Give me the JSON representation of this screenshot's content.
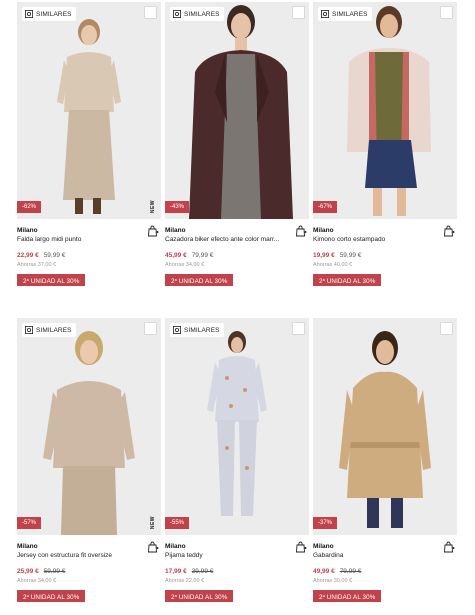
{
  "labels": {
    "similares": "SIMILARES",
    "new": "NEW",
    "promo_sup": "a",
    "promo_prefix": "2",
    "promo_suffix": " UNIDAD AL 30%"
  },
  "colors": {
    "accent": "#c0434b",
    "bg": "#ececec"
  },
  "products": [
    {
      "brand": "Milano",
      "name": "Falda largo midi punto",
      "discount": "-62%",
      "price": "22,99 €",
      "old_price": "59,99 €",
      "ahorras": "Ahorras 37,00 €",
      "new": true
    },
    {
      "brand": "Milano",
      "name": "Cazadora biker efecto ante color marr...",
      "discount": "-43%",
      "price": "45,99 €",
      "old_price": "79,99 €",
      "ahorras": "Ahorras 34,00 €",
      "new": false
    },
    {
      "brand": "Milano",
      "name": "Kimono corto estampado",
      "discount": "-67%",
      "price": "19,99 €",
      "old_price": "59,99 €",
      "ahorras": "Ahorras 40,00 €",
      "new": false
    },
    {
      "brand": "Milano",
      "name": "Jersey con estructura fit oversize",
      "discount": "-57%",
      "price": "25,99 €",
      "old_price": "59,99 €",
      "ahorras": "Ahorras 34,00 €",
      "new": true
    },
    {
      "brand": "Milano",
      "name": "Pijama teddy",
      "discount": "-55%",
      "price": "17,99 €",
      "old_price": "39,99 €",
      "ahorras": "Ahorras 22,00 €",
      "new": false
    },
    {
      "brand": "Milano",
      "name": "Gabardina",
      "discount": "-37%",
      "price": "49,99 €",
      "old_price": "79,99 €",
      "ahorras": "Ahorras 30,00 €",
      "new": false
    }
  ]
}
